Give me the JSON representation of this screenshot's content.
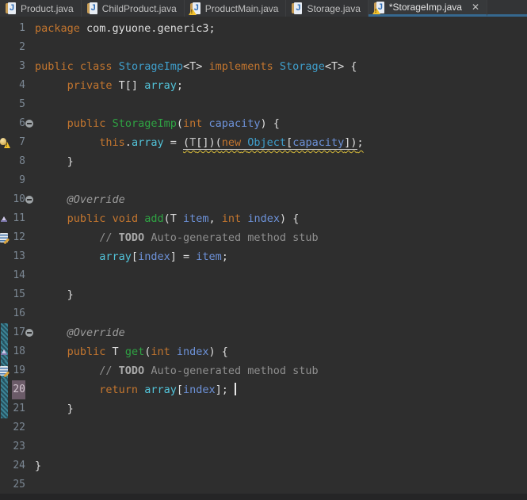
{
  "tab_bar": {
    "tabs": [
      {
        "label": "Product.java",
        "icon": "java-file-icon",
        "warning": false,
        "active": false,
        "closable": false
      },
      {
        "label": "ChildProduct.java",
        "icon": "java-file-icon",
        "warning": false,
        "active": false,
        "closable": false
      },
      {
        "label": "ProductMain.java",
        "icon": "java-file-icon",
        "warning": true,
        "active": false,
        "closable": false
      },
      {
        "label": "Storage.java",
        "icon": "java-file-icon",
        "warning": false,
        "active": false,
        "closable": false
      },
      {
        "label": "*StorageImp.java",
        "icon": "java-file-icon",
        "warning": true,
        "active": true,
        "closable": true
      }
    ],
    "icon_letter": "J",
    "close_glyph": "✕",
    "accent_color": "#36688F"
  },
  "editor": {
    "palette": {
      "editor_bg": "#2E2E2E",
      "tab_bg": "#333436",
      "keyword": "#C4762E",
      "type_name": "#3F9FCC",
      "method_name": "#2EA343",
      "field": "#52C3D9",
      "variable": "#6D92D9",
      "plain": "#DEDEDE",
      "comment": "#8F8F8F",
      "annotation": "#9C9C9C",
      "line_number": "#7B8793",
      "current_line_number_bg": "#6B5B68",
      "warning_squiggle": "#D8BC3A",
      "range_indicator": "#3C8496"
    },
    "lines": [
      {
        "n": 1,
        "tokens": [
          [
            "kw",
            "package"
          ],
          [
            "pl",
            " com.gyuone.generic3;"
          ]
        ]
      },
      {
        "n": 2,
        "tokens": []
      },
      {
        "n": 3,
        "tokens": [
          [
            "kw",
            "public"
          ],
          [
            "pl",
            " "
          ],
          [
            "kw",
            "class"
          ],
          [
            "pl",
            " "
          ],
          [
            "type",
            "StorageImp"
          ],
          [
            "pl",
            "<T> "
          ],
          [
            "kw",
            "implements"
          ],
          [
            "pl",
            " "
          ],
          [
            "type",
            "Storage"
          ],
          [
            "pl",
            "<T> {"
          ]
        ]
      },
      {
        "n": 4,
        "tokens": [
          [
            "pl",
            "     "
          ],
          [
            "kw",
            "private"
          ],
          [
            "pl",
            " T[] "
          ],
          [
            "field",
            "array"
          ],
          [
            "pl",
            ";"
          ]
        ]
      },
      {
        "n": 5,
        "tokens": []
      },
      {
        "n": 6,
        "fold": true,
        "tokens": [
          [
            "pl",
            "     "
          ],
          [
            "kw",
            "public"
          ],
          [
            "pl",
            " "
          ],
          [
            "method",
            "StorageImp"
          ],
          [
            "pl",
            "("
          ],
          [
            "kw",
            "int"
          ],
          [
            "pl",
            " "
          ],
          [
            "var",
            "capacity"
          ],
          [
            "pl",
            ") {"
          ]
        ]
      },
      {
        "n": 7,
        "marker": "warning",
        "tokens": [
          [
            "pl",
            "          "
          ],
          [
            "kw",
            "this"
          ],
          [
            "pl",
            "."
          ],
          [
            "field",
            "array"
          ],
          [
            "pl",
            " = "
          ],
          [
            "pl",
            "(",
            "uw"
          ],
          [
            "tp",
            "T",
            "uw"
          ],
          [
            "pl",
            "[])(",
            "uw"
          ],
          [
            "kw",
            "new",
            "uw"
          ],
          [
            "pl",
            " ",
            "uw"
          ],
          [
            "type",
            "Object",
            "uw"
          ],
          [
            "pl",
            "[",
            "uw"
          ],
          [
            "var",
            "capacity",
            "uw"
          ],
          [
            "pl",
            "])",
            "uw"
          ],
          [
            "pl",
            ";",
            "w"
          ]
        ]
      },
      {
        "n": 8,
        "tokens": [
          [
            "pl",
            "     }"
          ]
        ]
      },
      {
        "n": 9,
        "tokens": []
      },
      {
        "n": 10,
        "fold": true,
        "tokens": [
          [
            "ann",
            "     @Override"
          ]
        ]
      },
      {
        "n": 11,
        "marker": "override",
        "tokens": [
          [
            "pl",
            "     "
          ],
          [
            "kw",
            "public"
          ],
          [
            "pl",
            " "
          ],
          [
            "kw",
            "void"
          ],
          [
            "pl",
            " "
          ],
          [
            "method",
            "add"
          ],
          [
            "pl",
            "(T "
          ],
          [
            "var",
            "item"
          ],
          [
            "pl",
            ", "
          ],
          [
            "kw",
            "int"
          ],
          [
            "pl",
            " "
          ],
          [
            "var",
            "index"
          ],
          [
            "pl",
            ") {"
          ]
        ]
      },
      {
        "n": 12,
        "marker": "task",
        "tokens": [
          [
            "cm",
            "          // "
          ],
          [
            "todo",
            "TODO"
          ],
          [
            "cm",
            " Auto-generated method stub"
          ]
        ]
      },
      {
        "n": 13,
        "tokens": [
          [
            "pl",
            "          "
          ],
          [
            "field",
            "array"
          ],
          [
            "pl",
            "["
          ],
          [
            "var",
            "index"
          ],
          [
            "pl",
            "] = "
          ],
          [
            "var",
            "item"
          ],
          [
            "pl",
            ";"
          ]
        ]
      },
      {
        "n": 14,
        "tokens": []
      },
      {
        "n": 15,
        "tokens": [
          [
            "pl",
            "     }"
          ]
        ]
      },
      {
        "n": 16,
        "tokens": []
      },
      {
        "n": 17,
        "fold": true,
        "range": true,
        "tokens": [
          [
            "ann",
            "     @Override"
          ]
        ]
      },
      {
        "n": 18,
        "marker": "override",
        "range": true,
        "tokens": [
          [
            "pl",
            "     "
          ],
          [
            "kw",
            "public"
          ],
          [
            "pl",
            " T "
          ],
          [
            "method",
            "get"
          ],
          [
            "pl",
            "("
          ],
          [
            "kw",
            "int"
          ],
          [
            "pl",
            " "
          ],
          [
            "var",
            "index"
          ],
          [
            "pl",
            ") {"
          ]
        ]
      },
      {
        "n": 19,
        "marker": "task",
        "range": true,
        "tokens": [
          [
            "cm",
            "          // "
          ],
          [
            "todo",
            "TODO"
          ],
          [
            "cm",
            " Auto-generated method stub"
          ]
        ]
      },
      {
        "n": 20,
        "range": true,
        "current": true,
        "caret": true,
        "tokens": [
          [
            "pl",
            "          "
          ],
          [
            "kw",
            "return"
          ],
          [
            "pl",
            " "
          ],
          [
            "field",
            "array"
          ],
          [
            "pl",
            "["
          ],
          [
            "var",
            "index"
          ],
          [
            "pl",
            "]; "
          ]
        ]
      },
      {
        "n": 21,
        "range": true,
        "tokens": [
          [
            "pl",
            "     }"
          ]
        ]
      },
      {
        "n": 22,
        "tokens": []
      },
      {
        "n": 23,
        "tokens": []
      },
      {
        "n": 24,
        "tokens": [
          [
            "pl",
            "}"
          ]
        ]
      },
      {
        "n": 25,
        "tokens": []
      }
    ]
  }
}
